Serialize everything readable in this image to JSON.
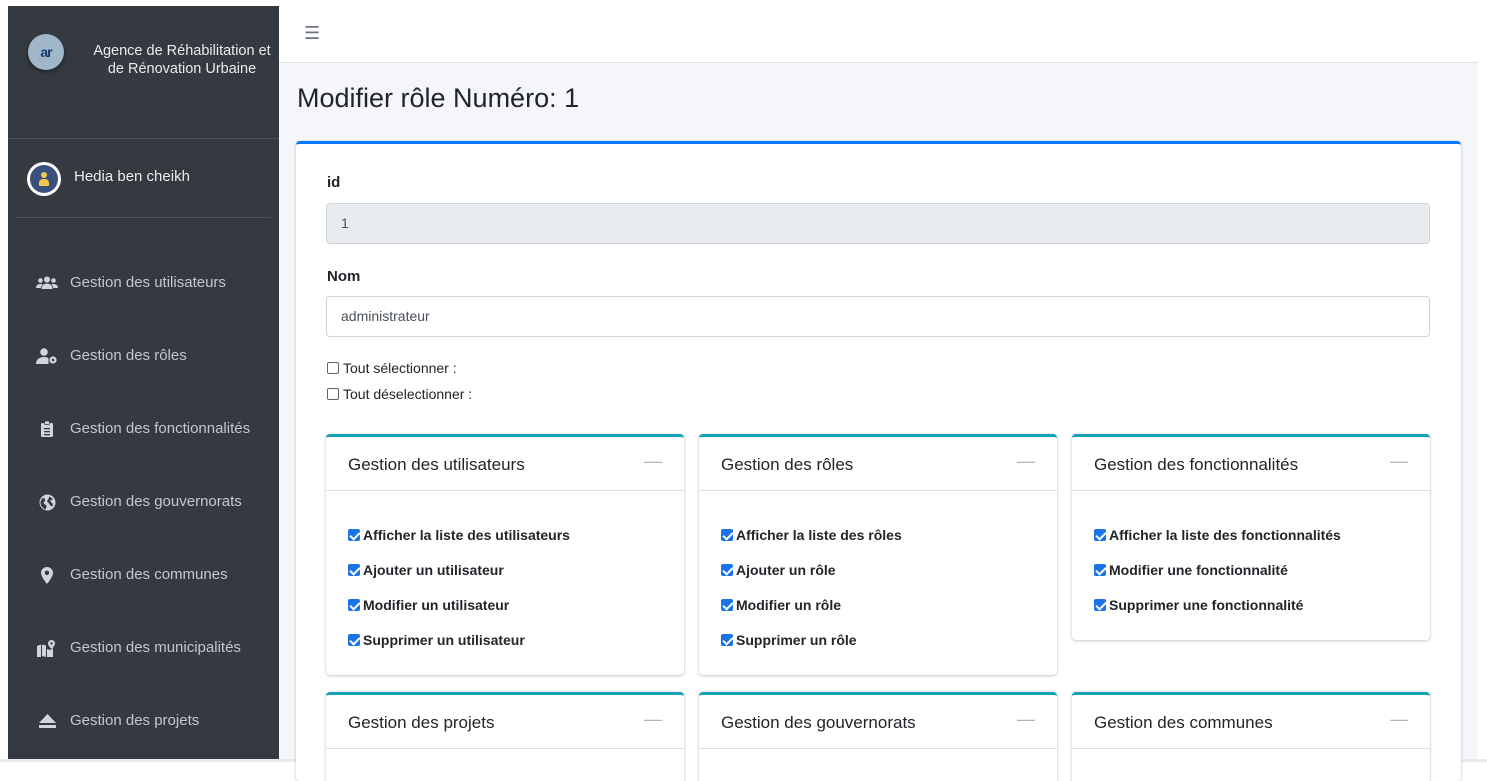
{
  "brand": {
    "logo_text": "ar",
    "name": "Agence de Réhabilitation et de Rénovation Urbaine"
  },
  "user": {
    "name": "Hedia ben cheikh"
  },
  "sidebar": {
    "items": [
      {
        "label": "Gestion des utilisateurs",
        "icon": "users-icon"
      },
      {
        "label": "Gestion des rôles",
        "icon": "user-cog-icon"
      },
      {
        "label": "Gestion des fonctionnalités",
        "icon": "clipboard-icon"
      },
      {
        "label": "Gestion des gouvernorats",
        "icon": "globe-icon"
      },
      {
        "label": "Gestion des communes",
        "icon": "map-marker-icon"
      },
      {
        "label": "Gestion des municipalités",
        "icon": "map-icon"
      },
      {
        "label": "Gestion des projets",
        "icon": "eject-icon"
      }
    ]
  },
  "topbar": {
    "menu_icon": "☰"
  },
  "page": {
    "title": "Modifier rôle Numéro: 1"
  },
  "form": {
    "id_label": "id",
    "id_value": "1",
    "nom_label": "Nom",
    "nom_value": "administrateur",
    "select_all": "Tout sélectionner :",
    "deselect_all": "Tout déselectionner :"
  },
  "panels": [
    {
      "title": "Gestion des utilisateurs",
      "items": [
        "Afficher la liste des utilisateurs",
        "Ajouter un utilisateur",
        "Modifier un utilisateur",
        "Supprimer un utilisateur"
      ]
    },
    {
      "title": "Gestion des rôles",
      "items": [
        "Afficher la liste des rôles",
        "Ajouter un rôle",
        "Modifier un rôle",
        "Supprimer un rôle"
      ]
    },
    {
      "title": "Gestion des fonctionnalités",
      "items": [
        "Afficher la liste des fonctionnalités",
        "Modifier une fonctionnalité",
        "Supprimer une fonctionnalité"
      ]
    },
    {
      "title": "Gestion des projets",
      "items": []
    },
    {
      "title": "Gestion des gouvernorats",
      "items": []
    },
    {
      "title": "Gestion des communes",
      "items": []
    }
  ],
  "colors": {
    "sidebar_bg": "#343a40",
    "card_accent": "#007bff",
    "panel_accent": "#17a2b8",
    "checkbox": "#1a73e8"
  }
}
